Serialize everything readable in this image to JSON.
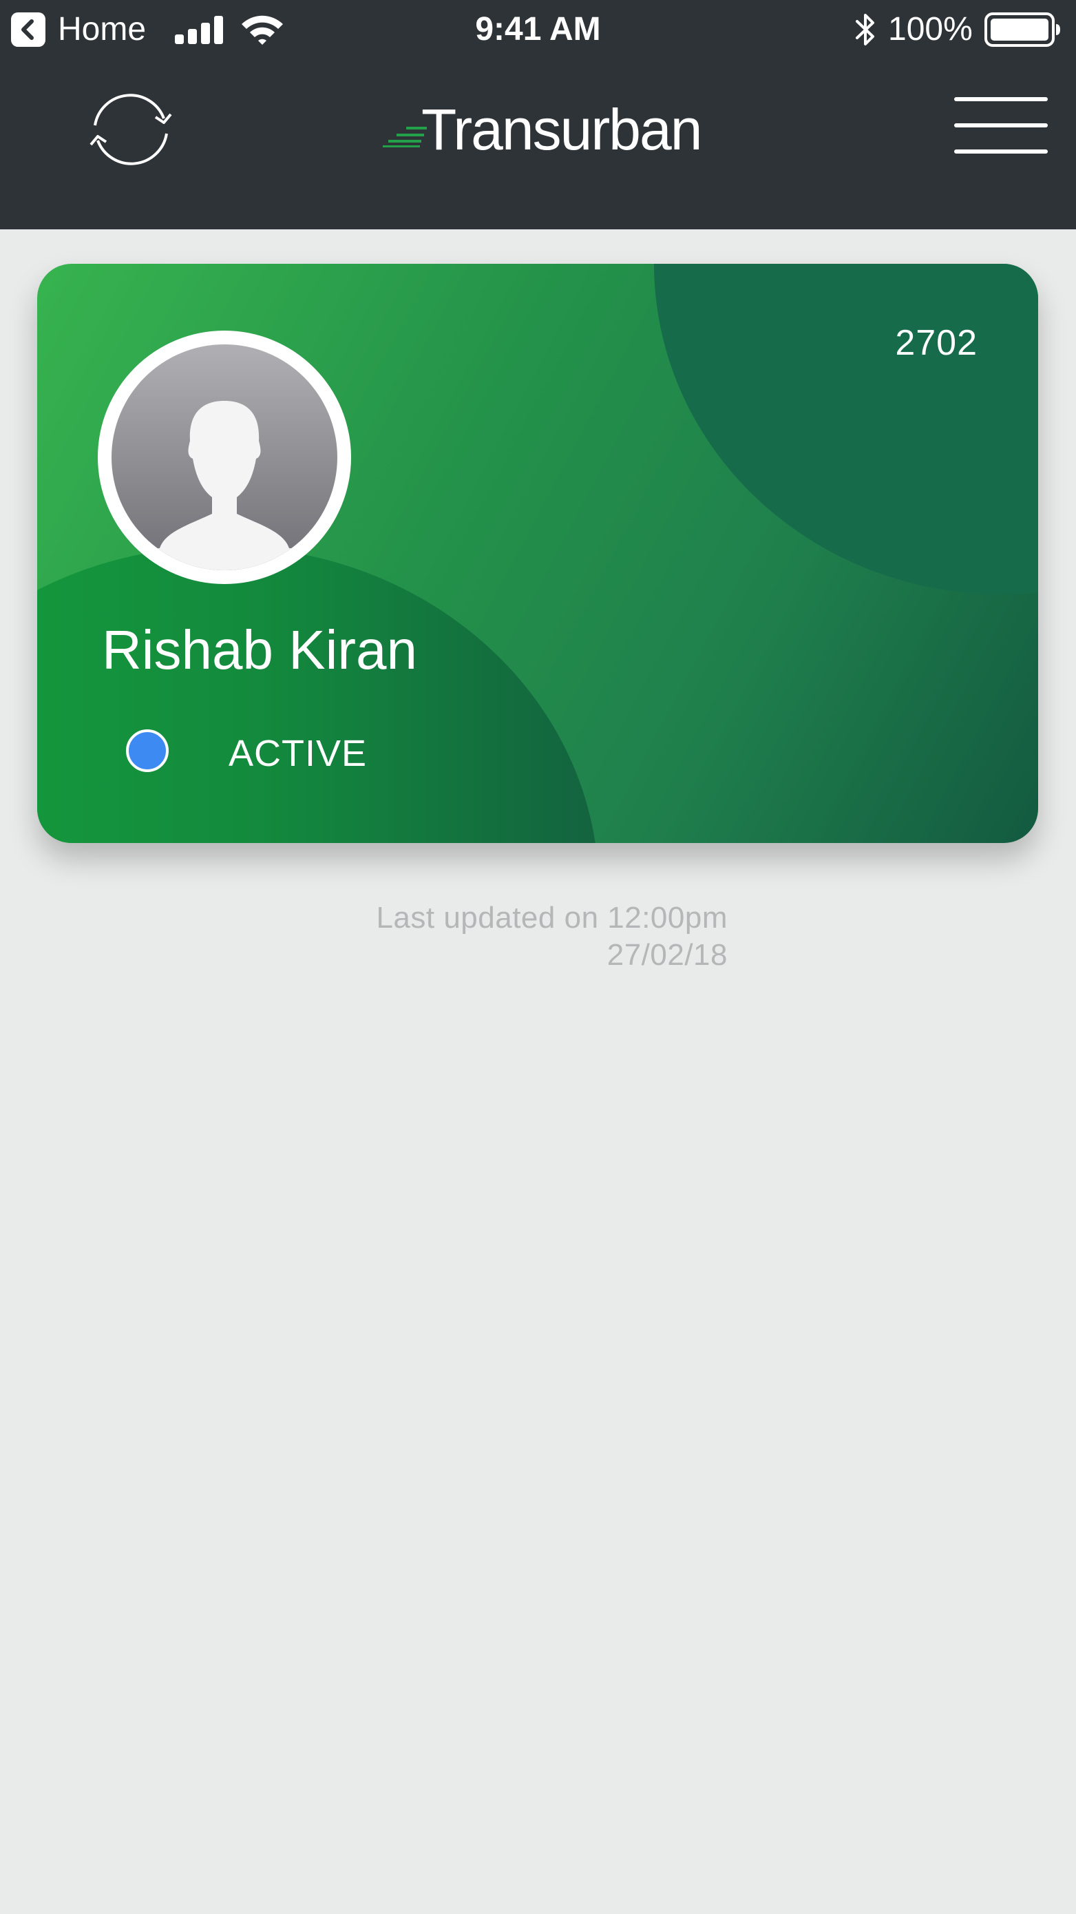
{
  "status_bar": {
    "back_label": "Home",
    "time": "9:41 AM",
    "battery": "100%",
    "icons": [
      "back-arrow-icon",
      "signal-icon",
      "wifi-icon",
      "bluetooth-icon",
      "battery-icon"
    ]
  },
  "header": {
    "logo_text": "Transurban",
    "refresh_icon": "refresh-icon",
    "menu_icon": "hamburger-menu-icon"
  },
  "card": {
    "number": "2702",
    "holder_name": "Rishab Kiran",
    "status": "ACTIVE",
    "status_color": "#3d8bf2",
    "gradient_start": "#37b34f",
    "gradient_end": "#135a40"
  },
  "last_updated": {
    "line1": "Last updated on 12:00pm",
    "line2": "27/02/18"
  },
  "colors": {
    "header_bg": "#2e3338",
    "page_bg": "#e9eaea",
    "brand_green": "#23a04a"
  }
}
